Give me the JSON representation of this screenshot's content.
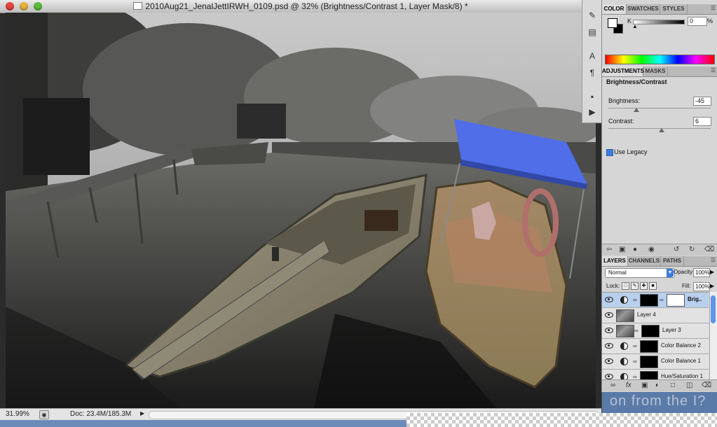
{
  "window": {
    "title": "2010Aug21_JenalJettIRWH_0109.psd @ 32% (Brightness/Contrast 1, Layer Mask/8) *"
  },
  "status": {
    "zoom": "31.99%",
    "doc_size": "Doc: 23.4M/185.3M"
  },
  "color_panel": {
    "tabs": [
      "COLOR",
      "SWATCHES",
      "STYLES"
    ],
    "channel_label": "K",
    "k_value": "0",
    "k_unit": "%"
  },
  "adjustments_panel": {
    "tabs": [
      "ADJUSTMENTS",
      "MASKS"
    ],
    "title": "Brightness/Contrast",
    "brightness_label": "Brightness:",
    "brightness_value": "-45",
    "contrast_label": "Contrast:",
    "contrast_value": "6",
    "use_legacy_label": "Use Legacy",
    "use_legacy_checked": true
  },
  "layers_panel": {
    "tabs": [
      "LAYERS",
      "CHANNELS",
      "PATHS"
    ],
    "blend_mode": "Normal",
    "opacity_label": "Opacity:",
    "opacity_value": "100%",
    "lock_label": "Lock:",
    "fill_label": "Fill:",
    "fill_value": "100%",
    "layers": [
      {
        "name": "Brig..",
        "type": "adjustment",
        "selected": true
      },
      {
        "name": "Layer 4",
        "type": "pixel",
        "selected": false
      },
      {
        "name": "Layer 3",
        "type": "pixel-mask",
        "selected": false
      },
      {
        "name": "Color Balance 2",
        "type": "adjustment",
        "selected": false
      },
      {
        "name": "Color Balance 1",
        "type": "adjustment",
        "selected": false
      },
      {
        "name": "Hue/Saturation 1",
        "type": "adjustment",
        "selected": false
      }
    ]
  },
  "watermark": "on from the I?"
}
